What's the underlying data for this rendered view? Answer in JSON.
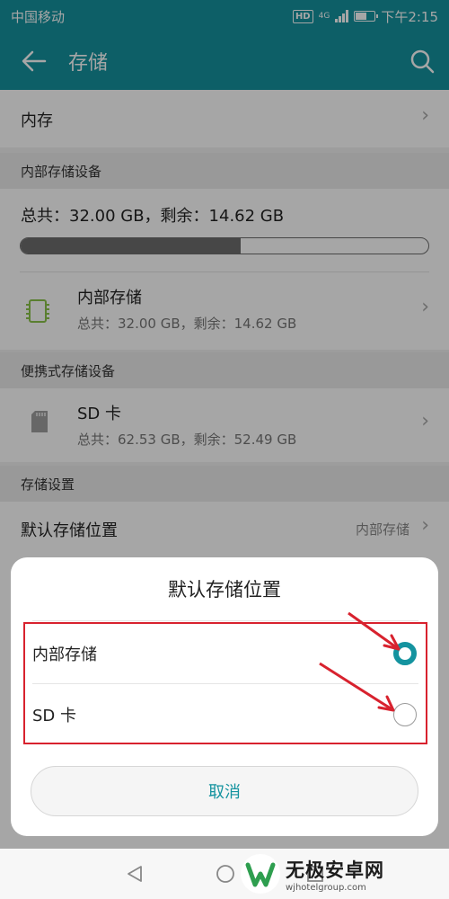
{
  "status_bar": {
    "carrier": "中国移动",
    "network": "4G",
    "hd": "HD",
    "time": "下午2:15",
    "battery_level": 0.6
  },
  "app_bar": {
    "title": "存储",
    "back_icon": "arrow-left-icon",
    "search_icon": "search-icon"
  },
  "memory_row": {
    "label": "内存"
  },
  "internal_section": {
    "header": "内部存储设备",
    "summary": "总共：32.00 GB，剩余：14.62 GB",
    "used_fraction": 0.54,
    "device": {
      "name": "内部存储",
      "detail": "总共：32.00 GB，剩余：14.62 GB",
      "icon": "chip-icon"
    }
  },
  "portable_section": {
    "header": "便携式存储设备",
    "device": {
      "name": "SD 卡",
      "detail": "总共：62.53 GB，剩余：52.49 GB",
      "icon": "sd-card-icon"
    }
  },
  "settings_section": {
    "header": "存储设置",
    "default_location": {
      "label": "默认存储位置",
      "value": "内部存储"
    }
  },
  "dialog": {
    "title": "默认存储位置",
    "options": [
      {
        "label": "内部存储",
        "selected": true
      },
      {
        "label": "SD 卡",
        "selected": false
      }
    ],
    "cancel_label": "取消",
    "highlight_color": "#d8222e",
    "accent_color": "#14939f"
  },
  "watermark": {
    "name": "无极安卓网",
    "url": "wjhotelgroup.com"
  }
}
